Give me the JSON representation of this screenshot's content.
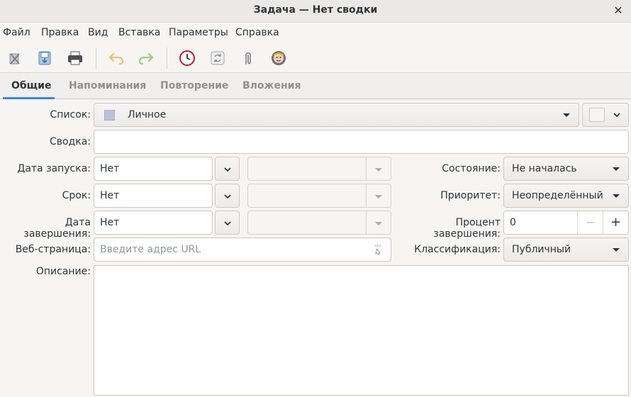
{
  "window": {
    "title": "Задача — Нет сводки",
    "close_glyph": "✕"
  },
  "menu": [
    "Файл",
    "Правка",
    "Вид",
    "Вставка",
    "Параметры",
    "Справка"
  ],
  "toolbar": {
    "icons": [
      "delete-icon",
      "save-icon",
      "print-icon",
      "undo-icon",
      "redo-icon",
      "clock-icon",
      "refresh-icon",
      "attachment-icon",
      "assign-icon"
    ]
  },
  "tabs": [
    "Общие",
    "Напоминания",
    "Повторение",
    "Вложения"
  ],
  "form": {
    "list_label": "Список:",
    "list_value": "Личное",
    "list_color": "#b8c4d6",
    "summary_label": "Сводка:",
    "summary_value": "",
    "start_label": "Дата запуска:",
    "start_value": "Нет",
    "due_label": "Срок:",
    "due_value": "Нет",
    "completed_label": "Дата завершения:",
    "completed_value": "Нет",
    "web_label": "Веб-страница:",
    "web_placeholder": "Введите адрес URL",
    "status_label": "Состояние:",
    "status_value": "Не началась",
    "priority_label": "Приоритет:",
    "priority_value": "Неопределённый",
    "percent_label": "Процент завершения:",
    "percent_value": "0",
    "minus": "−",
    "plus": "+",
    "class_label": "Классификация:",
    "class_value": "Публичный",
    "desc_label": "Описание:"
  },
  "colors": {
    "accent": "#3584e4"
  }
}
